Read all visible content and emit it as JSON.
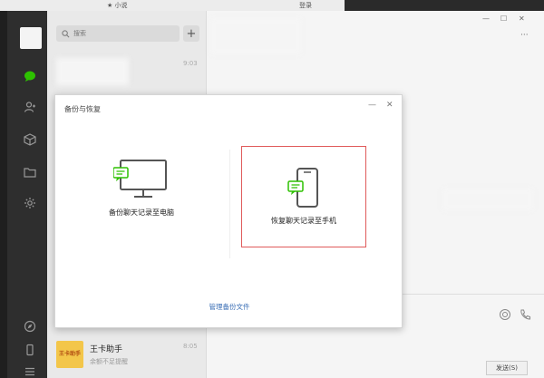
{
  "topbar": {
    "favorite_label": "★ 小说",
    "login_label": "登录"
  },
  "sidebar": {
    "items": [
      {
        "name": "chat-icon"
      },
      {
        "name": "contacts-icon"
      },
      {
        "name": "box-icon"
      },
      {
        "name": "folder-icon"
      },
      {
        "name": "settings-icon"
      },
      {
        "name": "compass-icon"
      },
      {
        "name": "phone-icon"
      },
      {
        "name": "menu-icon"
      }
    ],
    "active_color": "#2dc100"
  },
  "chatlist": {
    "search_placeholder": "搜索",
    "add_label": "+",
    "first_time": "9:03",
    "contact": {
      "avatar_text": "王卡助手",
      "name": "王卡助手",
      "subtitle": "余额不足提醒",
      "time": "8:05"
    }
  },
  "main": {
    "more_label": "···",
    "send_label": "发送(S)"
  },
  "dialog": {
    "title": "备份与恢复",
    "minimize_label": "—",
    "close_label": "✕",
    "backup_label": "备份聊天记录至电脑",
    "restore_label": "恢复聊天记录至手机",
    "manage_link": "管理备份文件",
    "highlight_color": "#e05a5a",
    "bubble_color": "#2dc100"
  }
}
